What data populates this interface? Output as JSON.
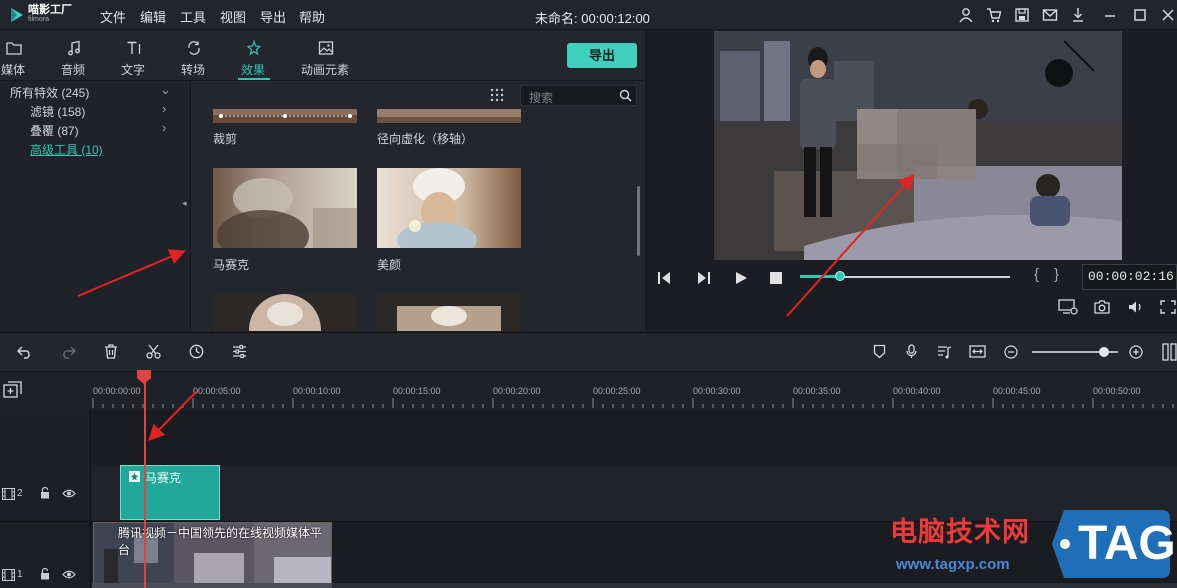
{
  "app": {
    "logo_main": "喵影工厂",
    "logo_sub": "filmora"
  },
  "menu": [
    "文件",
    "编辑",
    "工具",
    "视图",
    "导出",
    "帮助"
  ],
  "project_title": "未命名: 00:00:12:00",
  "library": {
    "tabs": [
      "媒体",
      "音频",
      "文字",
      "转场",
      "效果",
      "动画元素"
    ],
    "active_tab": "效果",
    "export_label": "导出",
    "search_placeholder": "搜索",
    "tree": [
      {
        "label": "所有特效 (245)"
      },
      {
        "label": "滤镜 (158)"
      },
      {
        "label": "叠覆 (87)"
      },
      {
        "label": "高级工具 (10)"
      }
    ],
    "effects": [
      "裁剪",
      "径向虚化（移轴）",
      "马赛克",
      "美颜"
    ]
  },
  "preview": {
    "timecode": "00:00:02:16",
    "progress": 0.19
  },
  "timeline": {
    "ruler_labels": [
      "00:00:00:00",
      "00:00:05:00",
      "00:00:10:00",
      "00:00:15:00",
      "00:00:20:00",
      "00:00:25:00",
      "00:00:30:00",
      "00:00:35:00",
      "00:00:40:00",
      "00:00:45:00",
      "00:00:50:00"
    ],
    "track2_num": "2",
    "track1_num": "1",
    "mosaic_clip_label": "马赛克",
    "video_clip_label": "腾讯视频－中国领先的在线视频媒体平台",
    "zoom_level": 0.84
  },
  "watermark": {
    "title": "电脑技术网",
    "url": "www.tagxp.com",
    "tag": "TAG"
  },
  "colors": {
    "accent": "#2fc7b6",
    "playhead": "#e04343",
    "annotation_arrow": "#e02424"
  }
}
